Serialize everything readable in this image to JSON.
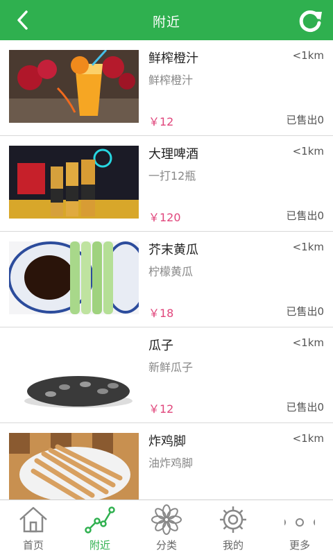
{
  "header": {
    "title": "附近",
    "back_icon": "chevron-left-icon",
    "refresh_icon": "refresh-icon",
    "color": "#2fb04f"
  },
  "items": [
    {
      "name": "鲜榨橙汁",
      "desc": "鲜榨橙汁",
      "distance": "<1km",
      "price": "￥12",
      "sold": "已售出0"
    },
    {
      "name": "大理啤酒",
      "desc": "一打12瓶",
      "distance": "<1km",
      "price": "￥120",
      "sold": "已售出0"
    },
    {
      "name": "芥末黄瓜",
      "desc": "柠檬黄瓜",
      "distance": "<1km",
      "price": "￥18",
      "sold": "已售出0"
    },
    {
      "name": "瓜子",
      "desc": "新鲜瓜子",
      "distance": "<1km",
      "price": "￥12",
      "sold": "已售出0"
    },
    {
      "name": "炸鸡脚",
      "desc": "油炸鸡脚",
      "distance": "<1km",
      "price": "",
      "sold": ""
    }
  ],
  "tabs": [
    {
      "label": "首页",
      "icon": "home-icon"
    },
    {
      "label": "附近",
      "icon": "nearby-route-icon",
      "active": true
    },
    {
      "label": "分类",
      "icon": "flower-category-icon"
    },
    {
      "label": "我的",
      "icon": "gear-icon"
    },
    {
      "label": "更多",
      "icon": "more-dots-icon"
    }
  ],
  "colors": {
    "accent": "#2fb04f",
    "price": "#e0457b"
  }
}
